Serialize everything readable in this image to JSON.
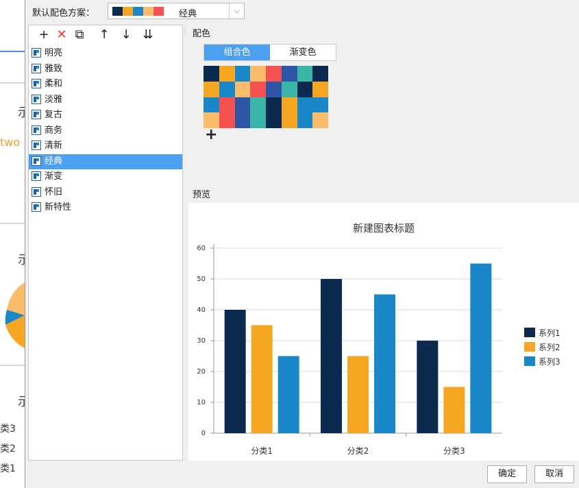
{
  "background_app": {
    "partial_text": "two",
    "category_labels": [
      "类3",
      "类2",
      "类1"
    ]
  },
  "dialog": {
    "default_scheme_label": "默认配色方案：",
    "default_scheme_value": "经典",
    "default_scheme_swatches": [
      "#0b2a4e",
      "#f5a623",
      "#1a87c9",
      "#fcbd6b",
      "#f45250"
    ]
  },
  "toolbar": {
    "items": [
      {
        "name": "add-icon",
        "glyph": "+"
      },
      {
        "name": "delete-icon",
        "glyph": "✕"
      },
      {
        "name": "copy-icon",
        "glyph": "⧉"
      },
      {
        "name": "move-up-icon",
        "glyph": "↑"
      },
      {
        "name": "move-down-icon",
        "glyph": "↓"
      },
      {
        "name": "sort-icon",
        "glyph": "⇊"
      }
    ]
  },
  "scheme_list": {
    "items": [
      "明亮",
      "雅致",
      "柔和",
      "淡雅",
      "复古",
      "商务",
      "清新",
      "经典",
      "渐变",
      "怀旧",
      "新特性"
    ],
    "selected_index": 7
  },
  "color_section": {
    "title": "配色",
    "tabs": [
      "组合色",
      "渐变色"
    ],
    "active_tab": 0,
    "palette_rows": [
      [
        "#0b2a4e",
        "#f5a623",
        "#1a87c9",
        "#fcbd6b",
        "#f45250",
        "#2f56a6",
        "#3ab5a8",
        "#0b2a4e"
      ],
      [
        "#f5a623",
        "#1a87c9",
        "#fcbd6b",
        "#f45250",
        "#2f56a6",
        "#3ab5a8",
        "#0b2a4e",
        "#f5a623"
      ],
      [
        "#1a87c9",
        "#f45250",
        "#2f56a6",
        "#3ab5a8",
        "#0b2a4e",
        "#f5a623",
        "#1a87c9",
        "#1a87c9"
      ],
      [
        "#fcbd6b",
        "#f45250",
        "#2f56a6",
        "#3ab5a8",
        "#0b2a4e",
        "#f5a623",
        "#1a87c9",
        "#fcbd6b"
      ]
    ],
    "add_glyph": "+"
  },
  "preview_section": {
    "title": "预览"
  },
  "chart_data": {
    "type": "bar",
    "title": "新建图表标题",
    "categories": [
      "分类1",
      "分类2",
      "分类3"
    ],
    "series": [
      {
        "name": "系列1",
        "color": "#0b2a4e",
        "values": [
          40,
          50,
          30
        ]
      },
      {
        "name": "系列2",
        "color": "#f5a623",
        "values": [
          35,
          25,
          15
        ]
      },
      {
        "name": "系列3",
        "color": "#1a87c9",
        "values": [
          25,
          45,
          55
        ]
      }
    ],
    "ylim": [
      0,
      60
    ],
    "yticks": [
      "0",
      "10",
      "20",
      "30",
      "40",
      "50",
      "60"
    ],
    "grid": true,
    "legend_position": "right"
  },
  "footer": {
    "ok_label": "确定",
    "cancel_label": "取消"
  }
}
